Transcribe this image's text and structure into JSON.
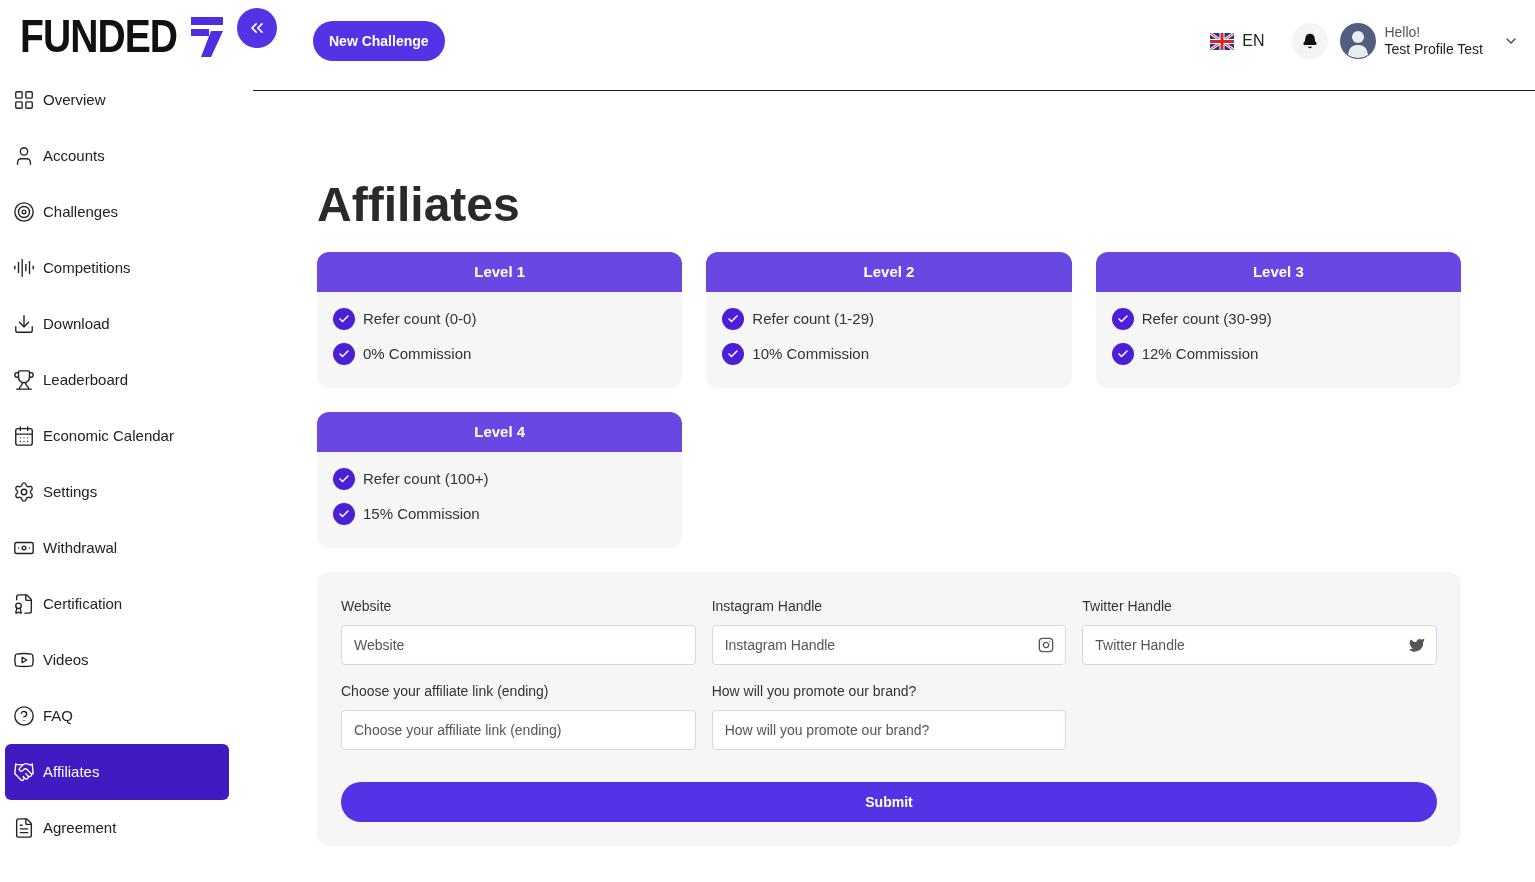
{
  "logo": {
    "text": "FUNDED"
  },
  "header": {
    "new_challenge": "New Challenge",
    "language": "EN",
    "greeting": "Hello!",
    "profile_name": "Test Profile Test"
  },
  "sidebar": {
    "items": [
      {
        "label": "Overview",
        "selected": false
      },
      {
        "label": "Accounts",
        "selected": false
      },
      {
        "label": "Challenges",
        "selected": false
      },
      {
        "label": "Competitions",
        "selected": false
      },
      {
        "label": "Download",
        "selected": false
      },
      {
        "label": "Leaderboard",
        "selected": false
      },
      {
        "label": "Economic Calendar",
        "selected": false
      },
      {
        "label": "Settings",
        "selected": false
      },
      {
        "label": "Withdrawal",
        "selected": false
      },
      {
        "label": "Certification",
        "selected": false
      },
      {
        "label": "Videos",
        "selected": false
      },
      {
        "label": "FAQ",
        "selected": false
      },
      {
        "label": "Affiliates",
        "selected": true
      },
      {
        "label": "Agreement",
        "selected": false
      }
    ]
  },
  "page_title": "Affiliates",
  "levels": [
    {
      "title": "Level 1",
      "features": [
        "Refer count (0-0)",
        "0% Commission"
      ]
    },
    {
      "title": "Level 2",
      "features": [
        "Refer count (1-29)",
        "10% Commission"
      ]
    },
    {
      "title": "Level 3",
      "features": [
        "Refer count (30-99)",
        "12% Commission"
      ]
    },
    {
      "title": "Level 4",
      "features": [
        "Refer count (100+)",
        "15% Commission"
      ]
    }
  ],
  "form": {
    "fields": [
      {
        "label": "Website",
        "placeholder": "Website",
        "kind": "plain"
      },
      {
        "label": "Instagram Handle",
        "placeholder": "Instagram Handle",
        "kind": "instagram"
      },
      {
        "label": "Twitter Handle",
        "placeholder": "Twitter Handle",
        "kind": "twitter"
      },
      {
        "label": "Choose your affiliate link (ending)",
        "placeholder": "Choose your affiliate link (ending)",
        "kind": "plain"
      },
      {
        "label": "How will you promote our brand?",
        "placeholder": "How will you promote our brand?",
        "kind": "plain"
      }
    ],
    "submit": "Submit"
  }
}
